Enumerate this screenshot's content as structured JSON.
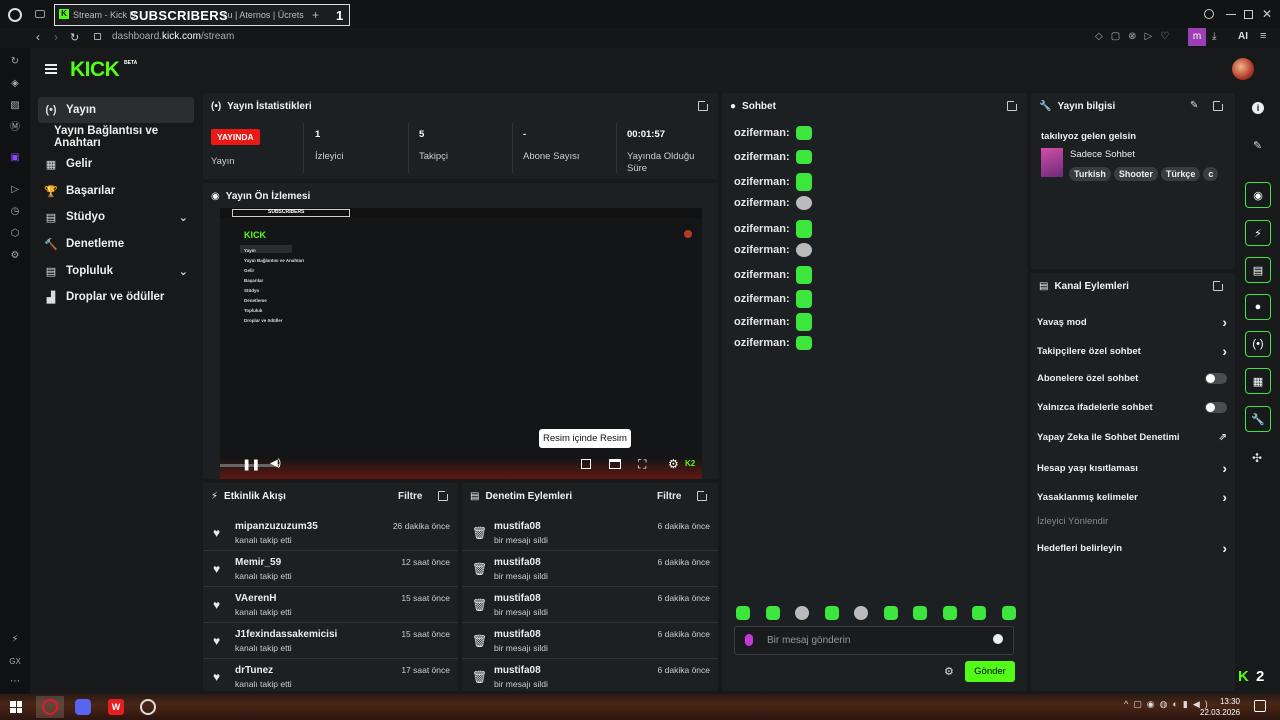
{
  "browser": {
    "tab_title": "Stream - Kick D",
    "tab_overlay": "SUBSCRIBERS",
    "tab_overlay_count": "1",
    "tab_other": "cu | Aternos | Ücrets",
    "url_prefix": "dashboard.",
    "url_domain": "kick.com",
    "url_path": "/stream",
    "ai_label": "AI",
    "profile_letter": "m"
  },
  "header": {
    "logo": "KICK",
    "logo_badge": "BETA"
  },
  "nav": {
    "items": [
      {
        "label": "Yayın",
        "icon": "(•)"
      },
      {
        "label": "Yayın Bağlantısı ve Anahtarı",
        "icon": ""
      },
      {
        "label": "Gelir",
        "icon": "▦"
      },
      {
        "label": "Başarılar",
        "icon": "🏆"
      },
      {
        "label": "Stüdyo",
        "icon": "▤"
      },
      {
        "label": "Denetleme",
        "icon": "🔨"
      },
      {
        "label": "Topluluk",
        "icon": "▤"
      },
      {
        "label": "Droplar ve ödüller",
        "icon": "▟"
      }
    ]
  },
  "stats": {
    "title": "Yayın İstatistikleri",
    "live_badge": "YAYINDA",
    "live_label": "Yayın",
    "viewers_value": "1",
    "viewers_label": "İzleyici",
    "followers_value": "5",
    "followers_label": "Takipçi",
    "subs_value": "-",
    "subs_label": "Abone Sayısı",
    "uptime_value": "00:01:57",
    "uptime_label": "Yayında Olduğu Süre"
  },
  "preview": {
    "title": "Yayın Ön İzlemesi",
    "tooltip": "Resim içinde Resim",
    "mini_nav": [
      "Yayın",
      "Yayın Bağlantısı ve Anahtarı",
      "Gelir",
      "Başarılar",
      "Stüdyo",
      "Denetleme",
      "Topluluk",
      "Droplar ve ödüller"
    ],
    "mini_overlay": "SUBSCRIBERS"
  },
  "activity": {
    "title": "Etkinlik Akışı",
    "filter": "Filtre",
    "rows": [
      {
        "name": "mipanzuzuzum35",
        "sub": "kanalı takip etti",
        "time": "26 dakika önce"
      },
      {
        "name": "Memir_59",
        "sub": "kanalı takip etti",
        "time": "12 saat önce"
      },
      {
        "name": "VAerenH",
        "sub": "kanalı takip etti",
        "time": "15 saat önce"
      },
      {
        "name": "J1fexindassakemicisi",
        "sub": "kanalı takip etti",
        "time": "15 saat önce"
      },
      {
        "name": "drTunez",
        "sub": "kanalı takip etti",
        "time": "17 saat önce"
      }
    ]
  },
  "moderation": {
    "title": "Denetim Eylemleri",
    "filter": "Filtre",
    "rows": [
      {
        "name": "mustifa08",
        "sub": "bir mesajı sildi",
        "time": "6 dakika önce"
      },
      {
        "name": "mustifa08",
        "sub": "bir mesajı sildi",
        "time": "6 dakika önce"
      },
      {
        "name": "mustifa08",
        "sub": "bir mesajı sildi",
        "time": "6 dakika önce"
      },
      {
        "name": "mustifa08",
        "sub": "bir mesajı sildi",
        "time": "6 dakika önce"
      },
      {
        "name": "mustifa08",
        "sub": "bir mesajı sildi",
        "time": "6 dakika önce"
      }
    ]
  },
  "chat": {
    "title": "Sohbet",
    "messages": [
      {
        "user": "oziferman:"
      },
      {
        "user": "oziferman:"
      },
      {
        "user": "oziferman:"
      },
      {
        "user": "oziferman:"
      },
      {
        "user": "oziferman:"
      },
      {
        "user": "oziferman:"
      },
      {
        "user": "oziferman:"
      },
      {
        "user": "oziferman:"
      },
      {
        "user": "oziferman:"
      },
      {
        "user": "oziferman:"
      }
    ],
    "placeholder": "Bir mesaj gönderin",
    "send": "Gönder"
  },
  "stream_info": {
    "title": "Yayın bilgisi",
    "stream_title": "takılıyoz gelen gelsin",
    "category": "Sadece Sohbet",
    "tags": [
      "Turkish",
      "Shooter",
      "Türkçe",
      "c"
    ]
  },
  "channel_actions": {
    "title": "Kanal Eylemleri",
    "items": [
      {
        "label": "Yavaş mod"
      },
      {
        "label": "Takipçilere özel sohbet"
      },
      {
        "label": "Abonelere özel sohbet"
      },
      {
        "label": "Yalnızca ifadelerle sohbet"
      },
      {
        "label": "Yapay Zeka ile Sohbet Denetimi"
      },
      {
        "label": "Hesap yaşı kısıtlaması"
      },
      {
        "label": "Yasaklanmış kelimeler"
      },
      {
        "label": "İzleyici Yönlendir"
      },
      {
        "label": "Hedefleri belirleyin"
      }
    ]
  },
  "taskbar": {
    "time": "13:30",
    "date": "22.03.2026"
  },
  "corner_badge": "2",
  "gx_label": "GX",
  "colors": {
    "accent": "#53fc18",
    "live": "#e91916"
  }
}
